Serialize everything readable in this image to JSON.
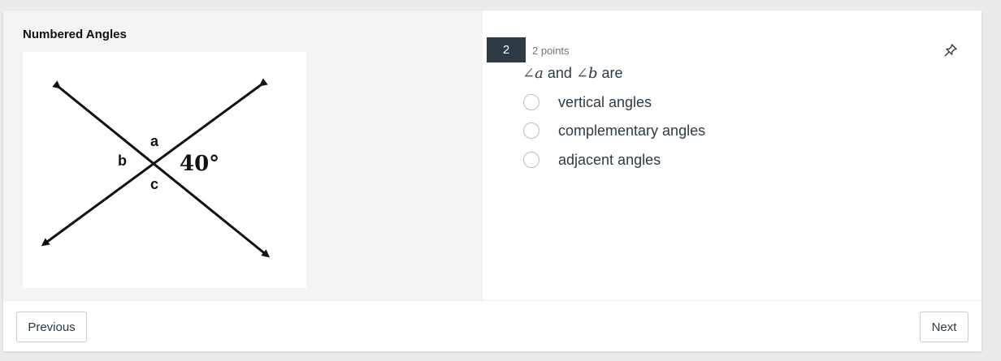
{
  "stimulus": {
    "title": "Numbered Angles",
    "figure": {
      "labels": {
        "a": "a",
        "b": "b",
        "c": "c",
        "angle": "40°"
      }
    }
  },
  "question": {
    "number": "2",
    "points": "2 points",
    "pin_icon": "pin-icon",
    "prompt": {
      "angle_symbol": "∠",
      "var1": "a",
      "connector": "and",
      "var2": "b",
      "tail": "are"
    },
    "options": [
      {
        "label": "vertical angles",
        "selected": false
      },
      {
        "label": "complementary angles",
        "selected": false
      },
      {
        "label": "adjacent angles",
        "selected": false
      }
    ]
  },
  "footer": {
    "previous_label": "Previous",
    "next_label": "Next"
  },
  "colors": {
    "question_badge": "#2d3b45",
    "left_panel_bg": "#f4f4f4",
    "text": "#2d3b45"
  }
}
